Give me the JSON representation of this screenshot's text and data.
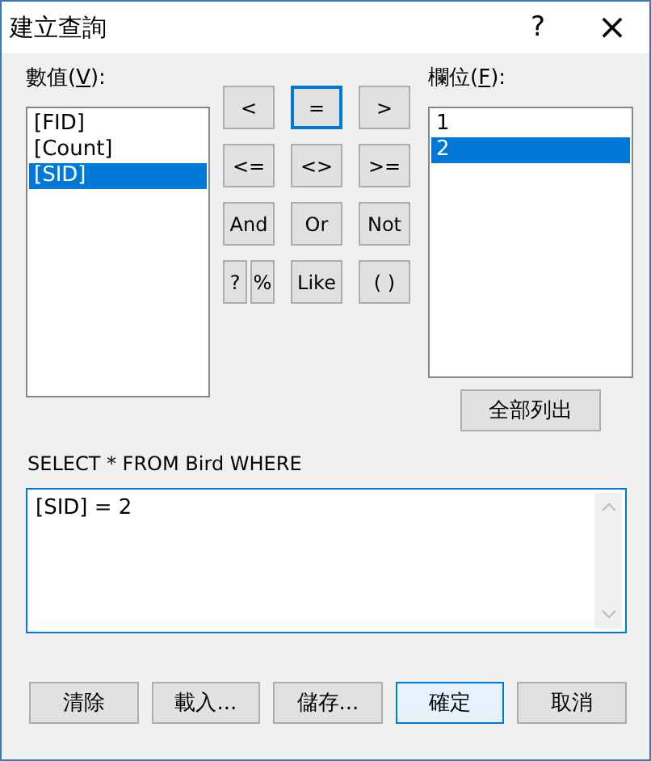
{
  "window": {
    "title": "建立查詢",
    "help": "?",
    "close": "×"
  },
  "values_label": {
    "before": "數值(",
    "key": "V",
    "after": "):"
  },
  "values": [
    {
      "text": "[FID]",
      "selected": false
    },
    {
      "text": "[Count]",
      "selected": false
    },
    {
      "text": "[SID]",
      "selected": true
    }
  ],
  "operators": [
    [
      {
        "text": "<",
        "kind": "normal",
        "focused": false
      },
      {
        "text": "=",
        "kind": "normal",
        "focused": true
      },
      {
        "text": ">",
        "kind": "normal",
        "focused": false
      }
    ],
    [
      {
        "text": "<=",
        "kind": "normal",
        "focused": false
      },
      {
        "text": "<>",
        "kind": "normal",
        "focused": false
      },
      {
        "text": ">=",
        "kind": "normal",
        "focused": false
      }
    ],
    [
      {
        "text": "And",
        "kind": "normal",
        "focused": false
      },
      {
        "text": "Or",
        "kind": "normal",
        "focused": false
      },
      {
        "text": "Not",
        "kind": "normal",
        "focused": false
      }
    ],
    [
      {
        "text": "?",
        "kind": "half",
        "focused": false
      },
      {
        "text": "%",
        "kind": "half",
        "focused": false
      },
      {
        "text": "Like",
        "kind": "normal",
        "focused": false
      },
      {
        "text": "( )",
        "kind": "normal",
        "focused": false
      }
    ]
  ],
  "fields_label": {
    "before": "欄位(",
    "key": "F",
    "after": "):"
  },
  "fields": [
    {
      "text": "1",
      "selected": false
    },
    {
      "text": "2",
      "selected": true
    }
  ],
  "list_all_button": "全部列出",
  "query_prefix": "SELECT * FROM Bird WHERE",
  "query": "[SID] = 2",
  "buttons": [
    {
      "label": "清除",
      "default": false
    },
    {
      "label": "載入...",
      "default": false
    },
    {
      "label": "儲存...",
      "default": false
    },
    {
      "label": "確定",
      "default": true
    },
    {
      "label": "取消",
      "default": false
    }
  ]
}
